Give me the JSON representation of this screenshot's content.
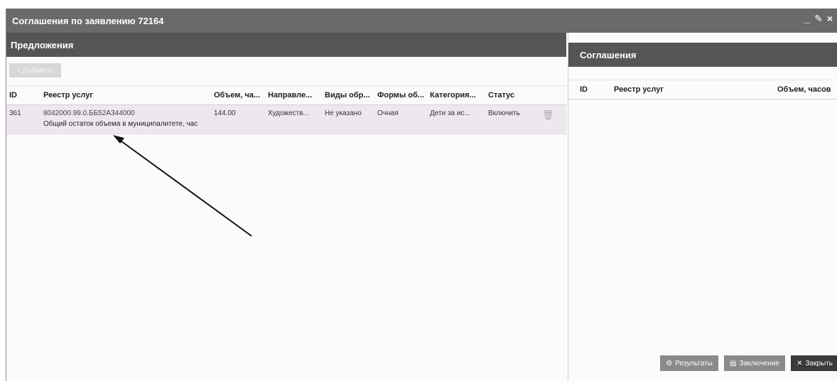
{
  "window": {
    "title": "Соглашения по заявлению 72164",
    "tools": [
      "_",
      "✎",
      "×"
    ]
  },
  "left_panel": {
    "header": "Предложения",
    "add_button": "+ Добавить",
    "columns": [
      "ID",
      "Реестр услуг",
      "Объем, ча...",
      "Направле...",
      "Виды обр...",
      "Формы об...",
      "Категория...",
      "Статус"
    ],
    "rows": [
      {
        "id": "361",
        "registry_code": "8042000.99.0.ББ52АЗ44000",
        "registry_note": "Общий остаток объема в муниципалитете, час",
        "volume": "144.00",
        "direction": "Художеств...",
        "kind": "Не указано",
        "form": "Очная",
        "category": "Дети за ис...",
        "status": "Включить"
      }
    ]
  },
  "right_panel": {
    "header": "Соглашения",
    "columns": [
      "ID",
      "Реестр услуг",
      "Объем, часов"
    ]
  },
  "footer": {
    "results_label": "Результаты",
    "conclusion_label": "Заключение",
    "close_label": "Закрыть"
  },
  "icons": {
    "delete": "trash-icon"
  },
  "colors": {
    "titlebar": "#6a6a6a",
    "panel_header": "#555555",
    "row_highlight": "#efe7ef"
  }
}
